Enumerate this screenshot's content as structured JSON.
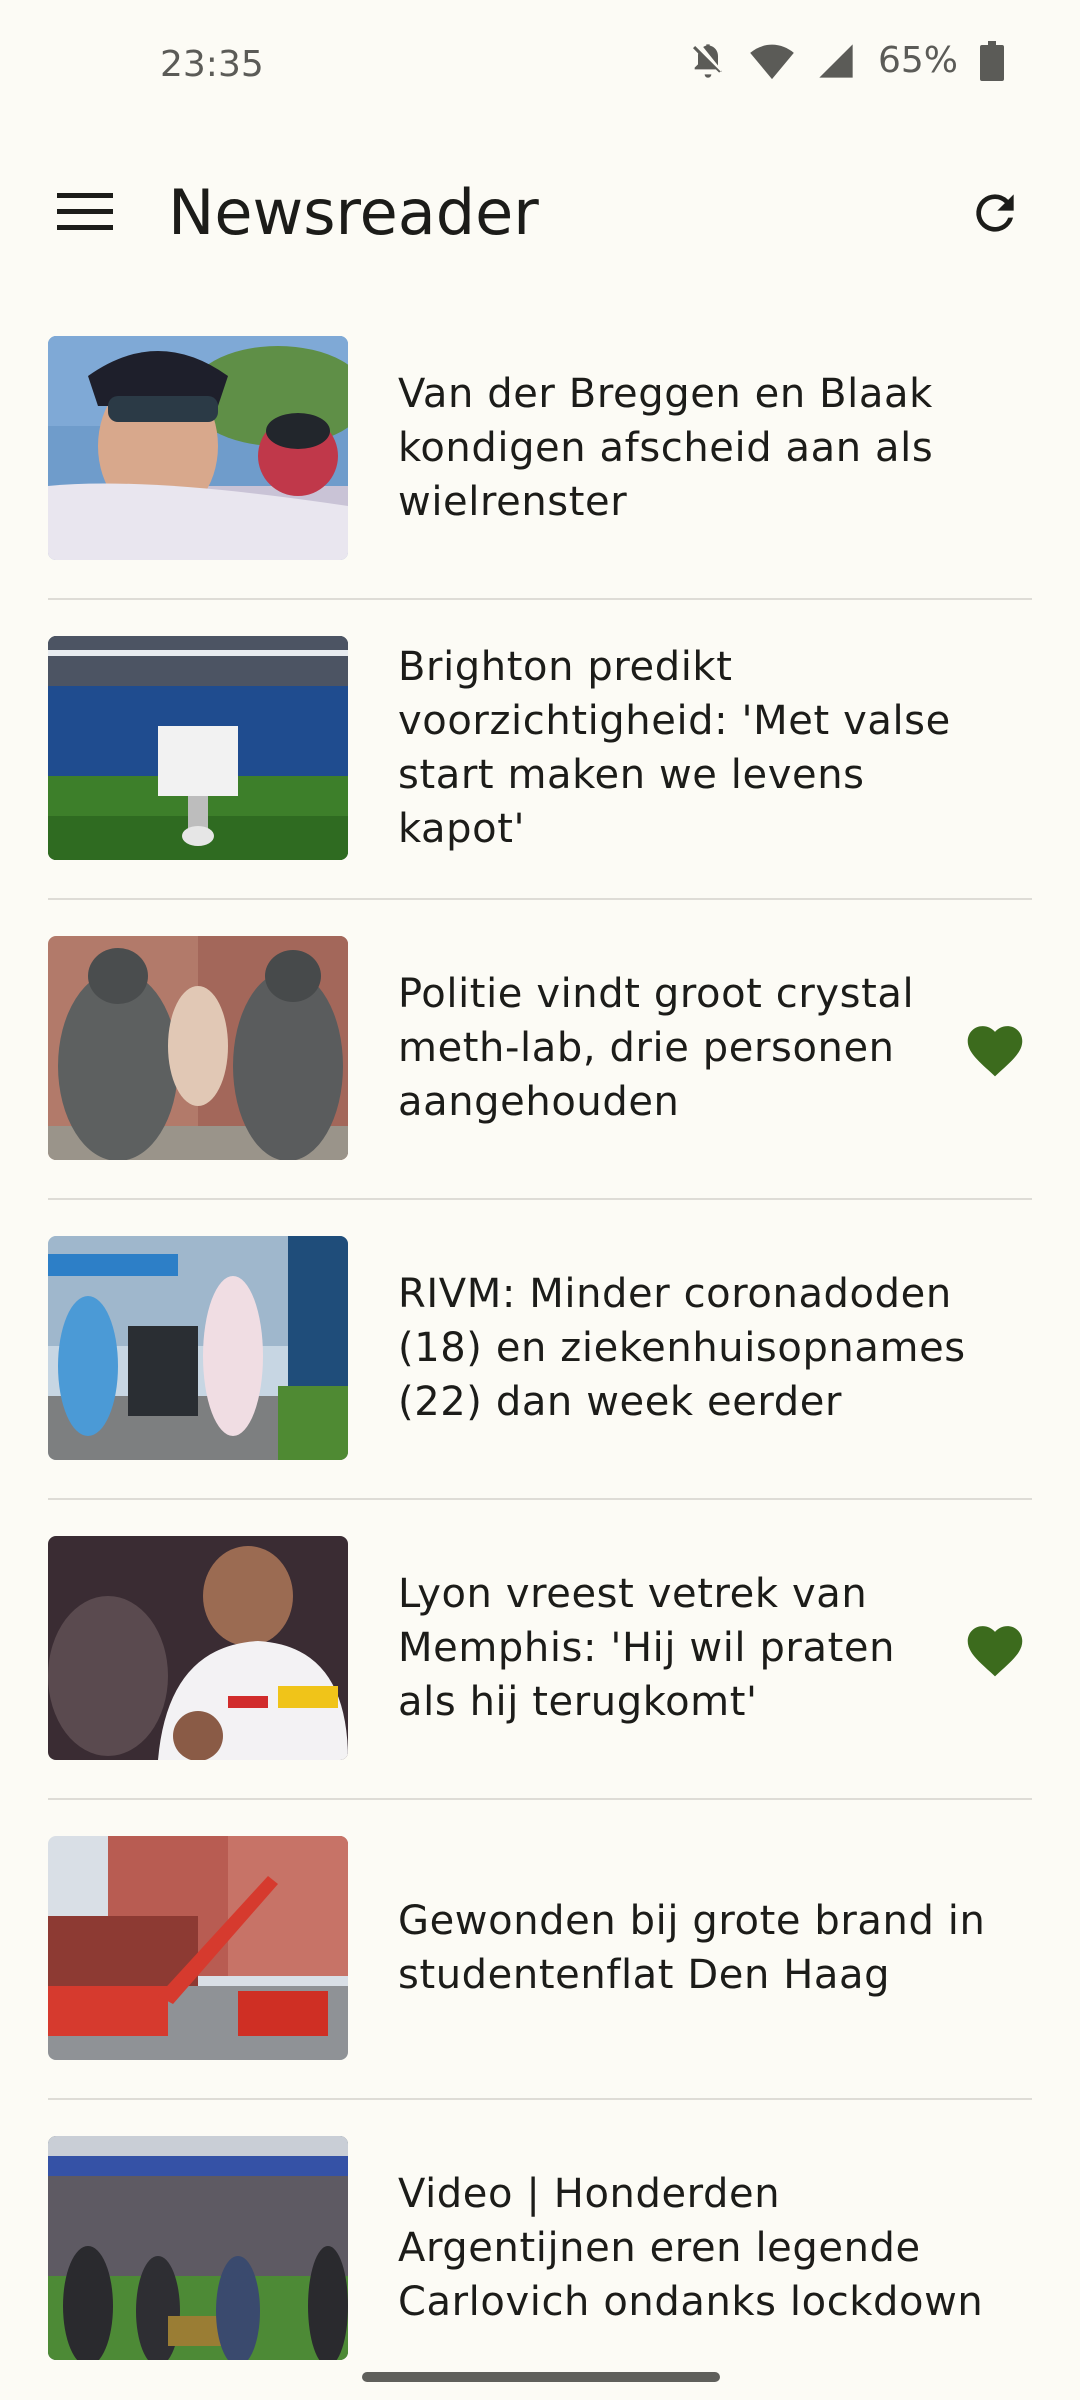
{
  "status_bar": {
    "time": "23:35",
    "battery": "65%",
    "icons": [
      "notifications-off-icon",
      "wifi-icon",
      "cellular-signal-icon",
      "battery-icon"
    ]
  },
  "app_bar": {
    "title": "Newsreader",
    "menu_icon": "hamburger-menu-icon",
    "refresh_icon": "refresh-icon"
  },
  "colors": {
    "background": "#fcfbf5",
    "favorite": "#3c6b1d",
    "divider": "#dedcd6",
    "text": "#1c1c19"
  },
  "articles": [
    {
      "title": "Van der Breggen en Blaak kondigen afscheid aan als wielrenster",
      "favorite": false
    },
    {
      "title": "Brighton predikt voorzichtigheid: 'Met valse start maken we levens kapot'",
      "favorite": false
    },
    {
      "title": "Politie vindt groot crystal meth-lab, drie personen aangehouden",
      "favorite": true
    },
    {
      "title": "RIVM: Minder coronadoden (18) en ziekenhuisopnames (22) dan week eerder",
      "favorite": false
    },
    {
      "title": "Lyon vreest vetrek van Memphis: 'Hij wil praten als hij terugkomt'",
      "favorite": true
    },
    {
      "title": "Gewonden bij grote brand in studentenflat Den Haag",
      "favorite": false
    },
    {
      "title": "Video | Honderden Argentijnen eren legende Carlovich ondanks lockdown",
      "favorite": false
    }
  ]
}
